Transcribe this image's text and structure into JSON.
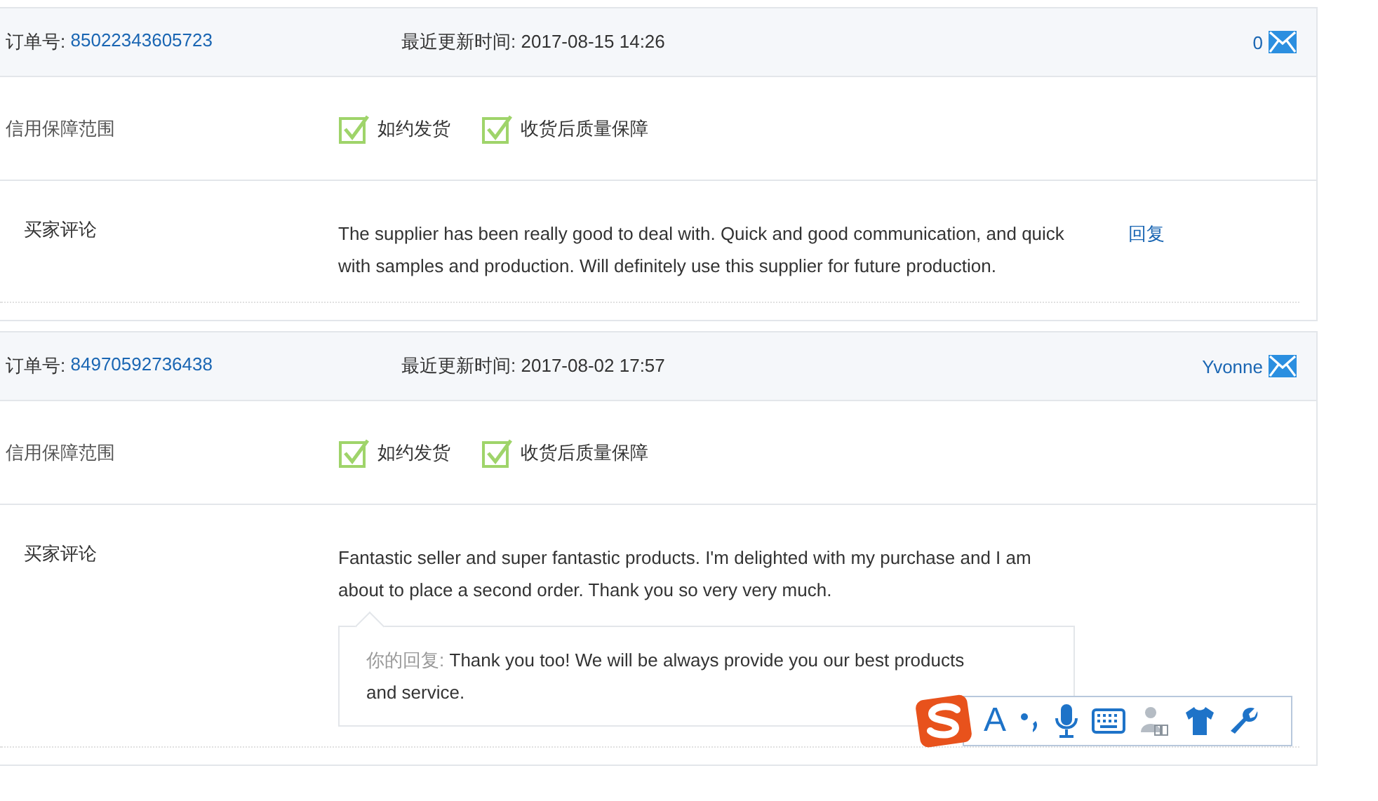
{
  "orders": [
    {
      "order_label": "订单号:",
      "order_number": "85022343605723",
      "updated_label": "最近更新时间:",
      "updated_time": "2017-08-15 14:26",
      "contact": "0",
      "guarantee_label": "信用保障范围",
      "guarantees": [
        {
          "label": "如约发货",
          "checked": true
        },
        {
          "label": "收货后质量保障",
          "checked": true
        }
      ],
      "comment_label": "买家评论",
      "comment": "The supplier has been really good to deal with. Quick and good communication, and quick with samples and production. Will definitely use this supplier for future production.",
      "reply_link": "回复"
    },
    {
      "order_label": "订单号:",
      "order_number": "84970592736438",
      "updated_label": "最近更新时间:",
      "updated_time": "2017-08-02 17:57",
      "contact": "Yvonne",
      "guarantee_label": "信用保障范围",
      "guarantees": [
        {
          "label": "如约发货",
          "checked": true
        },
        {
          "label": "收货后质量保障",
          "checked": true
        }
      ],
      "comment_label": "买家评论",
      "comment": "Fantastic seller and super fantastic products. I'm delighted with my purchase and I am about to place a second order. Thank you so very very much.",
      "reply": {
        "label": "你的回复:",
        "text": "Thank you too! We will be always provide you our best products and service."
      }
    }
  ],
  "ime_toolbar": {
    "mode": "A"
  }
}
